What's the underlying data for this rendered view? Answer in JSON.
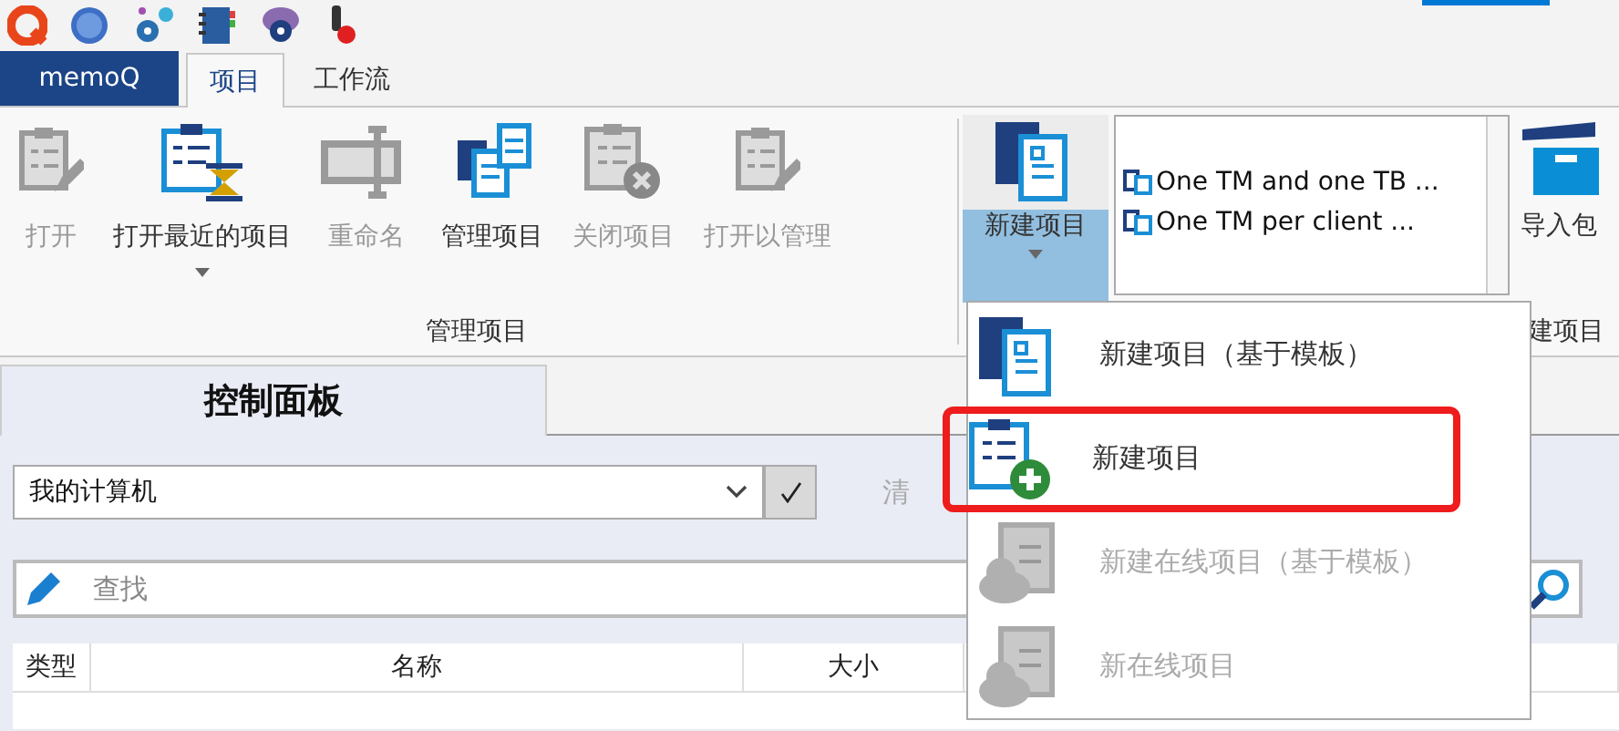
{
  "app_tabs": [
    {
      "label": "memoQ",
      "kind": "app"
    },
    {
      "label": "项目",
      "kind": "tab",
      "selected": true
    },
    {
      "label": "工作流",
      "kind": "tab",
      "selected": false
    }
  ],
  "ribbon": {
    "buttons": [
      {
        "label": "打开",
        "disabled": true,
        "dropdown": false,
        "kind": "edit"
      },
      {
        "label": "打开最近的项目",
        "disabled": false,
        "dropdown": true,
        "kind": "recent"
      },
      {
        "label": "重命名",
        "disabled": true,
        "dropdown": false,
        "kind": "rename"
      },
      {
        "label": "管理项目",
        "disabled": false,
        "dropdown": false,
        "kind": "manage"
      },
      {
        "label": "关闭项目",
        "disabled": true,
        "dropdown": false,
        "kind": "close"
      },
      {
        "label": "打开以管理",
        "disabled": true,
        "dropdown": false,
        "kind": "edit"
      }
    ],
    "group_label": "管理项目",
    "new_project": {
      "label": "新建项目",
      "pressed": true
    },
    "templates": [
      "One TM and one TB ...",
      "One TM per client ..."
    ],
    "import_label": "导入包",
    "group_label_2": "建项目"
  },
  "dropdown_menu": [
    {
      "label": "新建项目（基于模板）",
      "kind": "template",
      "disabled": false,
      "highlighted": false
    },
    {
      "label": "新建项目",
      "kind": "new",
      "disabled": false,
      "highlighted": true
    },
    {
      "label": "新建在线项目（基于模板）",
      "kind": "cloud",
      "disabled": true,
      "highlighted": false
    },
    {
      "label": "新在线项目",
      "kind": "cloud",
      "disabled": true,
      "highlighted": false
    }
  ],
  "panel": {
    "tab": "控制面板",
    "location": "我的计算机",
    "clear_label": "清",
    "search": {
      "placeholder": "查找"
    },
    "columns": [
      "类型",
      "名称",
      "大小"
    ]
  }
}
